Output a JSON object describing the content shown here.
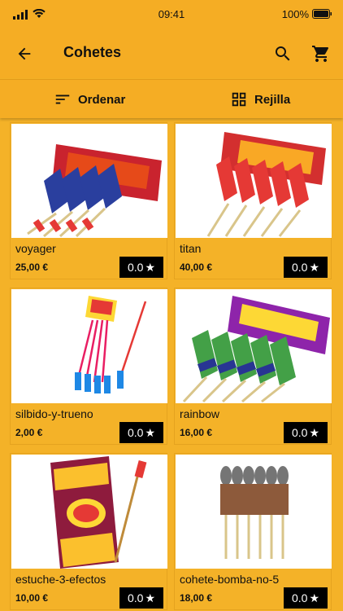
{
  "status_bar": {
    "time": "09:41",
    "battery": "100%"
  },
  "app_bar": {
    "title": "Cohetes",
    "back_icon": "arrow-left-icon",
    "search_icon": "search-icon",
    "cart_icon": "cart-icon"
  },
  "toolbar": {
    "sort_label": "Ordenar",
    "grid_label": "Rejilla"
  },
  "colors": {
    "accent": "#f4b228",
    "rating_bg": "#000000"
  },
  "products": [
    {
      "name": "voyager",
      "price": "25,00 €",
      "rating": "0.0"
    },
    {
      "name": "titan",
      "price": "40,00 €",
      "rating": "0.0"
    },
    {
      "name": "silbido-y-trueno",
      "price": "2,00 €",
      "rating": "0.0"
    },
    {
      "name": "rainbow",
      "price": "16,00 €",
      "rating": "0.0"
    },
    {
      "name": "estuche-3-efectos",
      "price": "10,00 €",
      "rating": "0.0"
    },
    {
      "name": "cohete-bomba-no-5",
      "price": "18,00 €",
      "rating": "0.0"
    }
  ]
}
